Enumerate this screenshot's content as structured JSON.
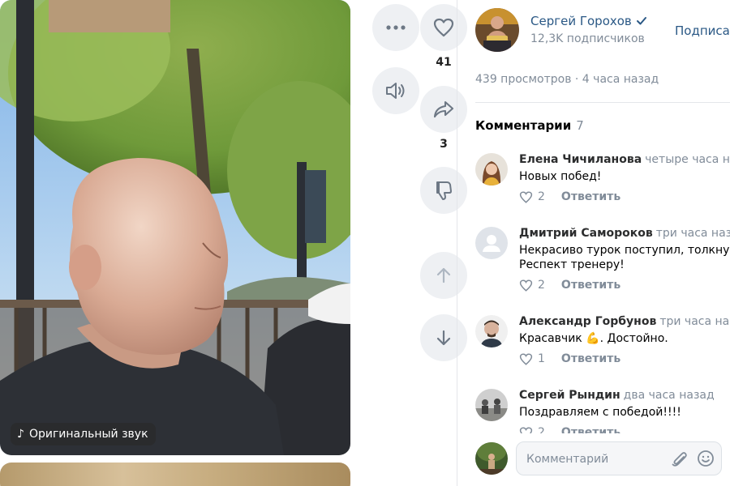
{
  "video": {
    "sound_label": "Оригинальный звук"
  },
  "actions": {
    "likes": "41",
    "shares": "3",
    "icons": [
      "more-icon",
      "heart-icon",
      "volume-icon",
      "share-icon",
      "dislike-icon",
      "arrow-up-icon",
      "arrow-down-icon"
    ]
  },
  "author": {
    "name": "Сергей Горохов",
    "subscribers": "12,3K подписчиков",
    "subscribe_label": "Подписаться"
  },
  "stats": {
    "views": "439 просмотров · 4 часа назад"
  },
  "comments": {
    "title": "Комментарии",
    "count": "7",
    "items": [
      {
        "name": "Елена Чичиланова",
        "time": "четыре часа назад",
        "text": "Новых побед!",
        "likes": "2",
        "reply": "Ответить"
      },
      {
        "name": "Дмитрий Самороков",
        "time": "три часа назад",
        "text": "Некрасиво турок поступил, толкнув тре\nРеспект тренеру!",
        "likes": "2",
        "reply": "Ответить"
      },
      {
        "name": "Александр Горбунов",
        "time": "три часа назад",
        "text": "Красавчик 💪. Достойно.",
        "likes": "1",
        "reply": "Ответить"
      },
      {
        "name": "Сергей Рындин",
        "time": "два часа назад",
        "text": "Поздравляем с победой!!!!",
        "likes": "2",
        "reply": "Ответить"
      }
    ]
  },
  "composer": {
    "placeholder": "Комментарий"
  },
  "colors": {
    "link": "#2a5885",
    "muted": "#818c99",
    "button_bg": "#eef0f3"
  }
}
